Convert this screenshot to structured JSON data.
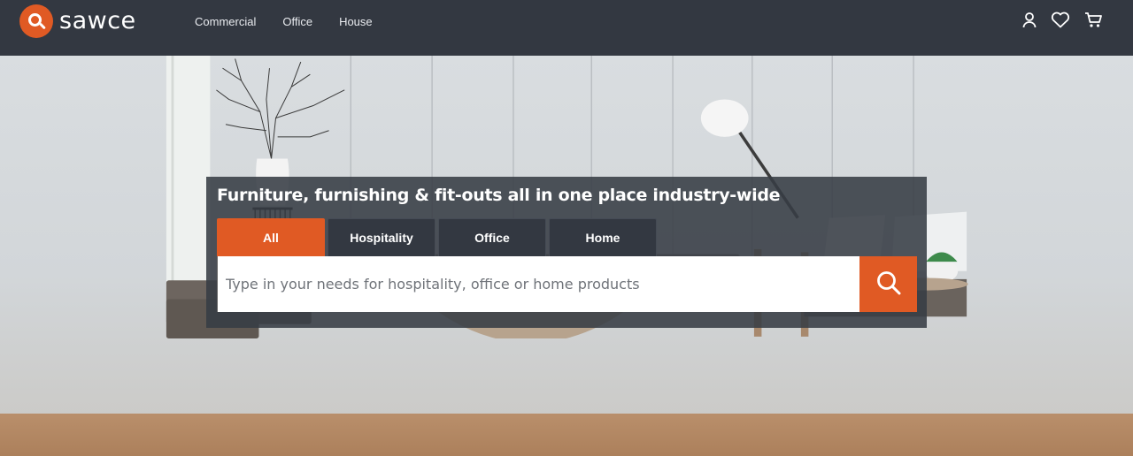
{
  "brand": {
    "name": "sawce",
    "accent_color": "#e05a24",
    "nav_bg": "#333841"
  },
  "nav": {
    "items": [
      {
        "label": "Commercial"
      },
      {
        "label": "Office"
      },
      {
        "label": "House"
      }
    ]
  },
  "header_icons": [
    "user-icon",
    "heart-icon",
    "cart-icon"
  ],
  "search": {
    "tagline": "Furniture, furnishing & fit-outs all in one place industry-wide",
    "tabs": [
      {
        "label": "All",
        "active": true
      },
      {
        "label": "Hospitality",
        "active": false
      },
      {
        "label": "Office",
        "active": false
      },
      {
        "label": "Home",
        "active": false
      }
    ],
    "placeholder": "Type in your needs for hospitality, office or home products",
    "value": "",
    "button_icon": "search-icon"
  }
}
